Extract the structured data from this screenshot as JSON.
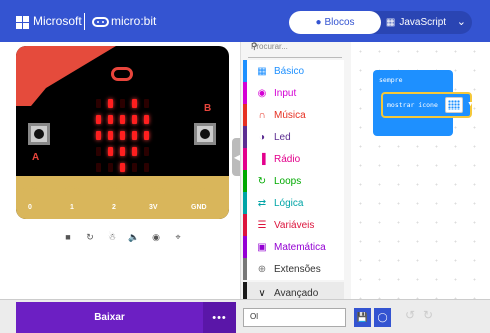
{
  "header": {
    "ms_brand": "Microsoft",
    "mb_brand": "micro:bit",
    "tab_blocks": "Blocos",
    "tab_js": "JavaScript",
    "colors": {
      "header_bg": "#3454d1",
      "active_tab_text": "#3454d1"
    }
  },
  "simulator": {
    "pins": [
      "0",
      "1",
      "2",
      "3V",
      "GND"
    ],
    "button_a": "A",
    "button_b": "B",
    "leds_on": [
      [
        0,
        1,
        0,
        1,
        0
      ],
      [
        1,
        1,
        1,
        1,
        1
      ],
      [
        1,
        1,
        1,
        1,
        1
      ],
      [
        0,
        1,
        1,
        1,
        0
      ],
      [
        0,
        0,
        1,
        0,
        0
      ]
    ],
    "controls": [
      "stop-icon",
      "restart-icon",
      "debug-icon",
      "sound-icon",
      "screenshot-icon",
      "fullscreen-icon"
    ]
  },
  "toolbox": {
    "search_placeholder": "Procurar...",
    "categories": [
      {
        "label": "Básico",
        "color": "#1e90ff",
        "icon": "grid-icon"
      },
      {
        "label": "Input",
        "color": "#d400d4",
        "icon": "circle-icon"
      },
      {
        "label": "Música",
        "color": "#e63022",
        "icon": "headphones-icon"
      },
      {
        "label": "Led",
        "color": "#5c2d91",
        "icon": "toggle-icon"
      },
      {
        "label": "Rádio",
        "color": "#e3008c",
        "icon": "signal-icon"
      },
      {
        "label": "Loops",
        "color": "#00aa00",
        "icon": "loop-icon"
      },
      {
        "label": "Lógica",
        "color": "#00a4a6",
        "icon": "shuffle-icon"
      },
      {
        "label": "Variáveis",
        "color": "#dc143c",
        "icon": "list-icon"
      },
      {
        "label": "Matemática",
        "color": "#9400d3",
        "icon": "calculator-icon"
      },
      {
        "label": "Extensões",
        "color": "#777777",
        "icon": "plus-icon"
      },
      {
        "label": "Avançado",
        "color": "#1b1b1b",
        "icon": "chevron-down-icon"
      }
    ]
  },
  "workspace": {
    "event_block": "sempre",
    "inner_block": "mostrar ícone"
  },
  "bottom": {
    "download": "Baixar",
    "more": "•••",
    "project_name": "Ol"
  }
}
